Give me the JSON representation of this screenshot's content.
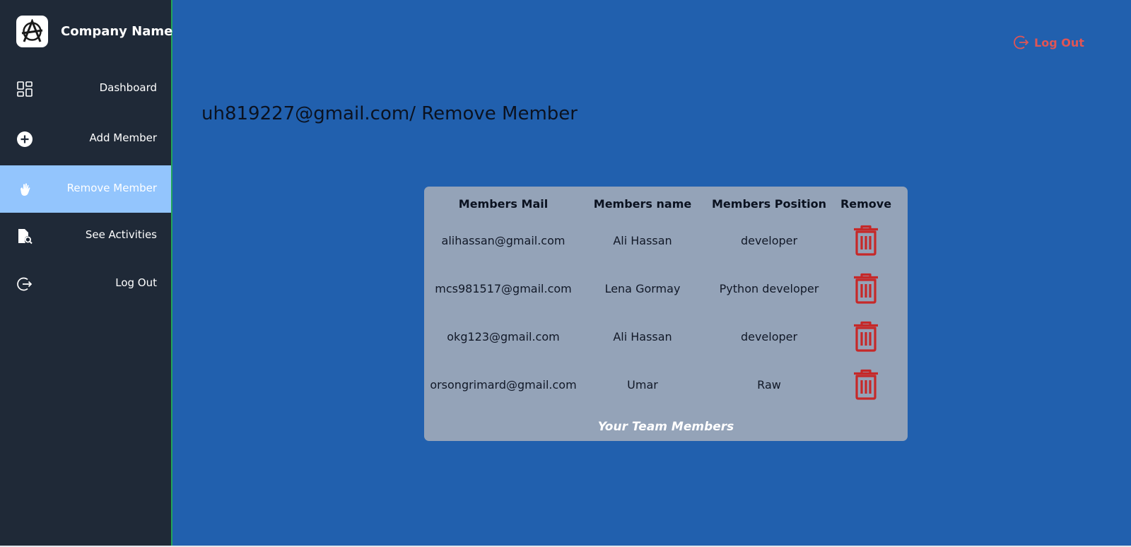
{
  "brand": {
    "name": "Company Name",
    "logo_icon": "anarchy-logo-icon"
  },
  "sidebar": {
    "items": [
      {
        "label": "Dashboard",
        "icon": "grid-icon",
        "active": false
      },
      {
        "label": "Add Member",
        "icon": "plus-circle-icon",
        "active": false
      },
      {
        "label": "Remove Member",
        "icon": "hand-icon",
        "active": true
      },
      {
        "label": "See Activities",
        "icon": "document-search-icon",
        "active": false
      },
      {
        "label": "Log Out",
        "icon": "logout-icon",
        "active": false
      }
    ]
  },
  "header": {
    "logout_label": "Log Out"
  },
  "page": {
    "title": "uh819227@gmail.com/ Remove Member"
  },
  "table": {
    "columns": [
      "Members Mail",
      "Members name",
      "Members Position",
      "Remove"
    ],
    "rows": [
      {
        "mail": "alihassan@gmail.com",
        "name": "Ali Hassan",
        "position": "developer"
      },
      {
        "mail": "mcs981517@gmail.com",
        "name": "Lena Gormay",
        "position": "Python developer"
      },
      {
        "mail": "okg123@gmail.com",
        "name": "Ali Hassan",
        "position": "developer"
      },
      {
        "mail": "orsongrimard@gmail.com",
        "name": "Umar",
        "position": "Raw"
      }
    ],
    "caption": "Your Team Members",
    "remove_icon": "trash-icon"
  },
  "colors": {
    "sidebar_bg": "#1f2937",
    "active_item_bg": "#93c5fd",
    "main_bg": "#2160ae",
    "card_bg": "#94a3b8",
    "danger": "#c62828",
    "logout_accent": "#e05555"
  }
}
